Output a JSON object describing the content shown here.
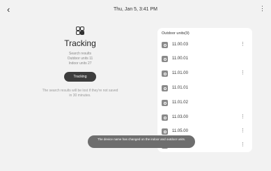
{
  "header": {
    "back_glyph": "‹",
    "title": "Thu, Jan 5, 3:41 PM",
    "more_glyph": "⋮"
  },
  "left": {
    "title": "Tracking",
    "results_heading": "Search results",
    "outdoor_line": "Outdoor units 11",
    "indoor_line": "Indoor units 27",
    "button_label": "Tracking",
    "warning": "The search results will be lost if they're not saved in 30 minutes."
  },
  "panel": {
    "title": "Outdoor units(9)",
    "items": [
      {
        "name": "11.00.03",
        "menu": "⋮"
      },
      {
        "name": "11.00.01",
        "menu": ""
      },
      {
        "name": "11.01.00",
        "menu": "⋮"
      },
      {
        "name": "11.01.01",
        "menu": ""
      },
      {
        "name": "11.01.02",
        "menu": ""
      },
      {
        "name": "11.03.00",
        "menu": "⋮"
      },
      {
        "name": "11.05.00",
        "menu": "⋮"
      },
      {
        "name": "",
        "menu": "⋮"
      }
    ]
  },
  "toast": {
    "message": "The device name has changed on the indoor and outdoor units."
  },
  "colors": {
    "background": "#f2f2f2",
    "button": "#3d3d3d",
    "toast": "#6e6e6e"
  }
}
